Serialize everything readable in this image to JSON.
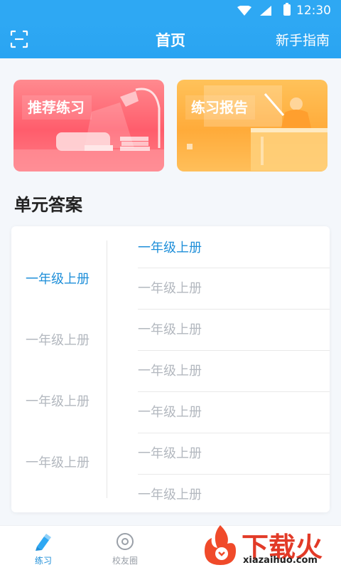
{
  "status_bar": {
    "time": "12:30"
  },
  "header": {
    "title": "首页",
    "right_link": "新手指南",
    "left_icon": "scan-icon"
  },
  "cards": [
    {
      "label": "推荐练习",
      "color": "#ff6b74"
    },
    {
      "label": "练习报告",
      "color": "#ffb547"
    }
  ],
  "section": {
    "title": "单元答案"
  },
  "left_column": {
    "items": [
      {
        "label": "一年级上册"
      },
      {
        "label": "一年级上册"
      },
      {
        "label": "一年级上册"
      },
      {
        "label": "一年级上册"
      }
    ],
    "selected_index": 0
  },
  "right_column": {
    "items": [
      {
        "label": "一年级上册"
      },
      {
        "label": "一年级上册"
      },
      {
        "label": "一年级上册"
      },
      {
        "label": "一年级上册"
      },
      {
        "label": "一年级上册"
      },
      {
        "label": "一年级上册"
      },
      {
        "label": "一年级上册"
      }
    ],
    "selected_index": 0
  },
  "tab_bar": {
    "items": [
      {
        "label": "练习",
        "icon": "pencil-icon"
      },
      {
        "label": "校友圈",
        "icon": "circle-icon"
      }
    ],
    "active_index": 0
  },
  "watermark": {
    "brand": "下载火",
    "url": "xiazaihuo.com"
  },
  "colors": {
    "primary": "#2ea8f3",
    "active_text": "#1f8fd9",
    "inactive_text": "#b3b8bf"
  }
}
